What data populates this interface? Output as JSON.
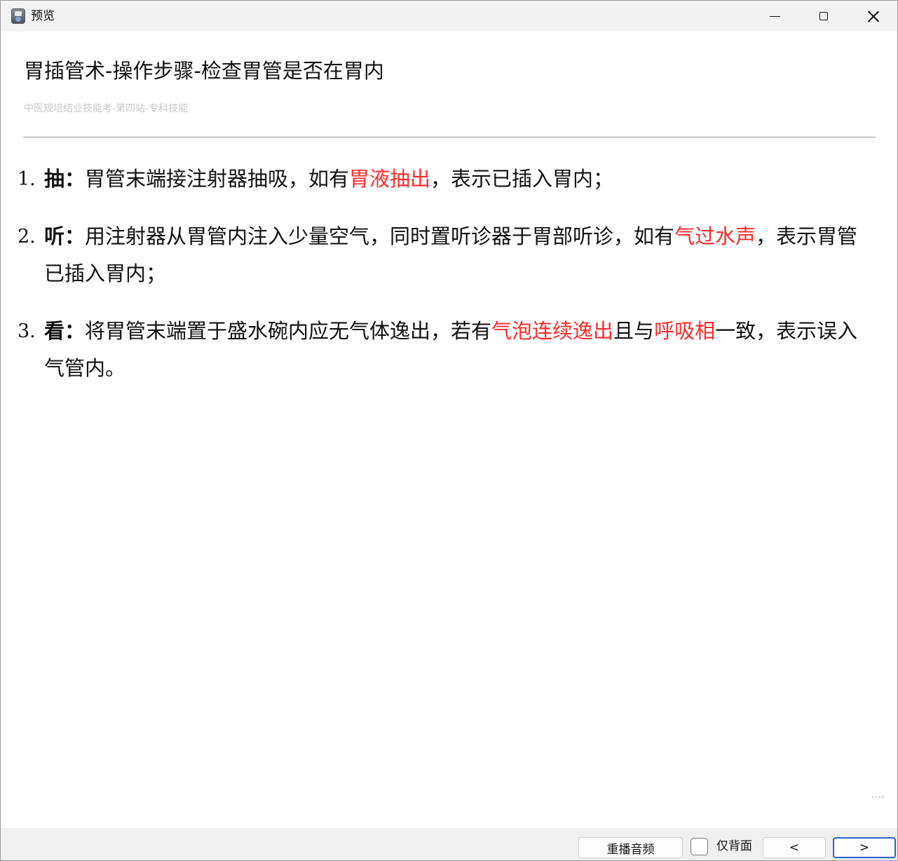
{
  "window": {
    "title": "预览",
    "icon": "app-icon",
    "controls": [
      "minimize-icon",
      "maximize-icon",
      "close-icon"
    ]
  },
  "main": {
    "title": "胃插管术-操作步骤-检查胃管是否在胃内",
    "subtitle": "中医规培结业技能考-第四站-专科技能",
    "steps": [
      {
        "number": "1.",
        "key": "抽：",
        "text_a": "胃管末端接注射器抽吸，如有",
        "red_a": "胃液抽出",
        "text_b": "，表示已插入胃内；"
      },
      {
        "number": "2.",
        "key": "听：",
        "text_a": "用注射器从胃管内注入少量空气，同时置听诊器于胃部听诊，如有",
        "red_a": "气过水声",
        "text_b": "，表示胃管已插入胃内；"
      },
      {
        "number": "3.",
        "key": "看：",
        "text_a": "将胃管末端置于盛水碗内应无气体逸出，若有",
        "red_a": "气泡连续逸出",
        "text_b": "且与",
        "red_b": "呼吸相",
        "text_c": "一致，表示误入气管内。"
      }
    ],
    "highlight_color": "#ff2a2a"
  },
  "footer": {
    "replay_label": "重播音频",
    "back_only_label": "仅背面",
    "back_only_checked": false,
    "prev_label": "<",
    "next_label": ">"
  }
}
